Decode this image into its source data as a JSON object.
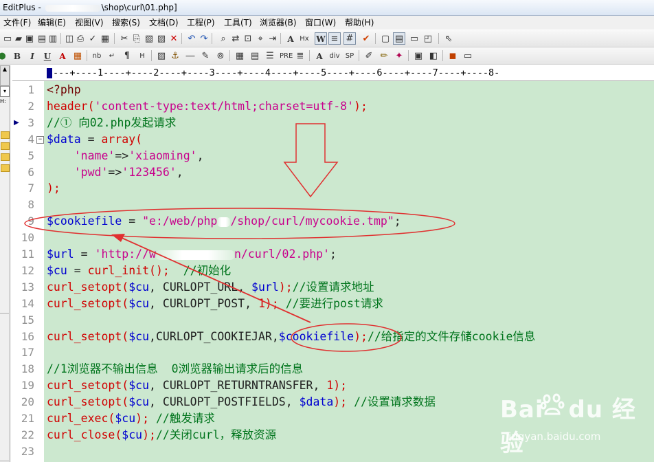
{
  "window": {
    "title_prefix": "EditPlus - ",
    "title_suffix": "\\shop\\curl\\01.php]"
  },
  "menu": [
    "文件(F)",
    "编辑(E)",
    "视图(V)",
    "搜索(S)",
    "文档(D)",
    "工程(P)",
    "工具(T)",
    "浏览器(B)",
    "窗口(W)",
    "帮助(H)"
  ],
  "toolbar2_text": {
    "bold": "B",
    "italic": "I",
    "underline": "U",
    "text_color": "A",
    "nbsp": "nb",
    "para": "¶",
    "hr": "H",
    "pre": "PRE",
    "div": "div",
    "sp": "SP"
  },
  "left_panel": {
    "label": "H:"
  },
  "ruler": "---+----1----+----2----+----3----+----4----+----5----+----6----+----7----+----8-",
  "editor": {
    "lines": [
      {
        "n": "1",
        "segments": [
          {
            "t": "<?php",
            "c": "c-php"
          }
        ]
      },
      {
        "n": "2",
        "segments": [
          {
            "t": "header(",
            "c": "c-red"
          },
          {
            "t": "'content-type:text/html;charset=utf-8'",
            "c": "c-mag"
          },
          {
            "t": ");",
            "c": "c-red"
          }
        ]
      },
      {
        "n": "3",
        "segments": [
          {
            "t": "//① 向02.php发起请求",
            "c": "c-grn"
          }
        ]
      },
      {
        "n": "4",
        "segments": [
          {
            "t": "$data",
            "c": "c-blue"
          },
          {
            "t": " = ",
            "c": "c-blk"
          },
          {
            "t": "array(",
            "c": "c-red"
          }
        ]
      },
      {
        "n": "5",
        "segments": [
          {
            "t": "    'name'",
            "c": "c-mag"
          },
          {
            "t": "=>",
            "c": "c-blk"
          },
          {
            "t": "'xiaoming'",
            "c": "c-mag"
          },
          {
            "t": ",",
            "c": "c-blk"
          }
        ]
      },
      {
        "n": "6",
        "segments": [
          {
            "t": "    'pwd'",
            "c": "c-mag"
          },
          {
            "t": "=>",
            "c": "c-blk"
          },
          {
            "t": "'123456'",
            "c": "c-mag"
          },
          {
            "t": ",",
            "c": "c-blk"
          }
        ]
      },
      {
        "n": "7",
        "segments": [
          {
            "t": ");",
            "c": "c-red"
          }
        ]
      },
      {
        "n": "8",
        "segments": []
      },
      {
        "n": "9",
        "segments": [
          {
            "t": "$cookiefile",
            "c": "c-blue"
          },
          {
            "t": " = ",
            "c": "c-blk"
          },
          {
            "t": "\"e:/web/php",
            "c": "c-mag"
          },
          {
            "t": "__",
            "c": "redact-slot"
          },
          {
            "t": "/shop/curl/mycookie.tmp\"",
            "c": "c-mag"
          },
          {
            "t": ";",
            "c": "c-blk"
          }
        ]
      },
      {
        "n": "10",
        "segments": []
      },
      {
        "n": "11",
        "segments": [
          {
            "t": "$url",
            "c": "c-blue"
          },
          {
            "t": " = ",
            "c": "c-blk"
          },
          {
            "t": "'http://w",
            "c": "c-mag"
          },
          {
            "t": "____________",
            "c": "redact-slot"
          },
          {
            "t": "n/curl/02.php'",
            "c": "c-mag"
          },
          {
            "t": ";",
            "c": "c-blk"
          }
        ]
      },
      {
        "n": "12",
        "segments": [
          {
            "t": "$cu",
            "c": "c-blue"
          },
          {
            "t": " = ",
            "c": "c-blk"
          },
          {
            "t": "curl_init();",
            "c": "c-red"
          },
          {
            "t": "  //初始化",
            "c": "c-grn"
          }
        ]
      },
      {
        "n": "13",
        "segments": [
          {
            "t": "curl_setopt(",
            "c": "c-red"
          },
          {
            "t": "$cu",
            "c": "c-blue"
          },
          {
            "t": ", CURLOPT_URL, ",
            "c": "c-blk"
          },
          {
            "t": "$url",
            "c": "c-blue"
          },
          {
            "t": ");",
            "c": "c-red"
          },
          {
            "t": "//设置请求地址",
            "c": "c-grn"
          }
        ]
      },
      {
        "n": "14",
        "segments": [
          {
            "t": "curl_setopt(",
            "c": "c-red"
          },
          {
            "t": "$cu",
            "c": "c-blue"
          },
          {
            "t": ", CURLOPT_POST, ",
            "c": "c-blk"
          },
          {
            "t": "1",
            "c": "c-red"
          },
          {
            "t": "); ",
            "c": "c-red"
          },
          {
            "t": "//要进行post请求",
            "c": "c-grn"
          }
        ]
      },
      {
        "n": "15",
        "segments": []
      },
      {
        "n": "16",
        "segments": [
          {
            "t": "curl_setopt(",
            "c": "c-red"
          },
          {
            "t": "$cu",
            "c": "c-blue"
          },
          {
            "t": ",CURLOPT_COOKIEJAR,",
            "c": "c-blk"
          },
          {
            "t": "$cookiefile",
            "c": "c-blue"
          },
          {
            "t": ");",
            "c": "c-red"
          },
          {
            "t": "//给指定的文件存储cookie信息",
            "c": "c-grn"
          }
        ]
      },
      {
        "n": "17",
        "segments": []
      },
      {
        "n": "18",
        "segments": [
          {
            "t": "//1浏览器不输出信息  0浏览器输出请求后的信息",
            "c": "c-grn"
          }
        ]
      },
      {
        "n": "19",
        "segments": [
          {
            "t": "curl_setopt(",
            "c": "c-red"
          },
          {
            "t": "$cu",
            "c": "c-blue"
          },
          {
            "t": ", CURLOPT_RETURNTRANSFER, ",
            "c": "c-blk"
          },
          {
            "t": "1",
            "c": "c-red"
          },
          {
            "t": ");",
            "c": "c-red"
          }
        ]
      },
      {
        "n": "20",
        "segments": [
          {
            "t": "curl_setopt(",
            "c": "c-red"
          },
          {
            "t": "$cu",
            "c": "c-blue"
          },
          {
            "t": ", CURLOPT_POSTFIELDS, ",
            "c": "c-blk"
          },
          {
            "t": "$data",
            "c": "c-blue"
          },
          {
            "t": "); ",
            "c": "c-red"
          },
          {
            "t": "//设置请求数据",
            "c": "c-grn"
          }
        ]
      },
      {
        "n": "21",
        "segments": [
          {
            "t": "curl_exec(",
            "c": "c-red"
          },
          {
            "t": "$cu",
            "c": "c-blue"
          },
          {
            "t": "); ",
            "c": "c-red"
          },
          {
            "t": "//触发请求",
            "c": "c-grn"
          }
        ]
      },
      {
        "n": "22",
        "segments": [
          {
            "t": "curl_close(",
            "c": "c-red"
          },
          {
            "t": "$cu",
            "c": "c-blue"
          },
          {
            "t": ");",
            "c": "c-red"
          },
          {
            "t": "//关闭curl，释放资源",
            "c": "c-grn"
          }
        ]
      },
      {
        "n": "23",
        "segments": []
      }
    ]
  },
  "watermark": {
    "logo_left": "Bai",
    "logo_right": "du 经验",
    "url": "jingyan.baidu.com"
  },
  "colors": {
    "editor_bg": "#cce8cf",
    "annotation_red": "#e03030"
  }
}
